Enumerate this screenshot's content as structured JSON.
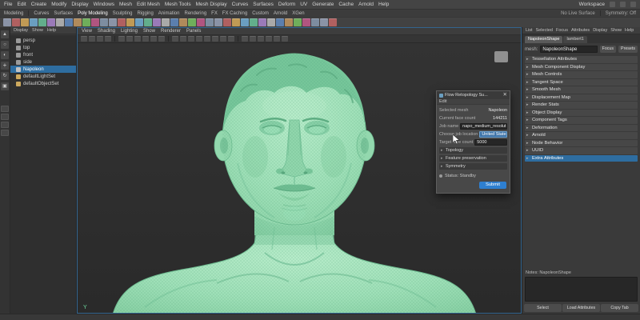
{
  "menubar": {
    "items": [
      "File",
      "Edit",
      "Create",
      "Modify",
      "Display",
      "Windows",
      "Mesh",
      "Edit Mesh",
      "Mesh Tools",
      "Mesh Display",
      "Curves",
      "Surfaces",
      "Deform",
      "UV",
      "Generate",
      "Cache",
      "Arnold",
      "Help"
    ],
    "workspace_label": "Workspace"
  },
  "statusline": {
    "menuset": "Modeling",
    "live_surface": "No Live Surface",
    "symmetry": "Symmetry: Off"
  },
  "shelf": {
    "tabs": [
      "Curves",
      "Surfaces",
      "Poly Modeling",
      "Sculpting",
      "Rigging",
      "Animation",
      "Rendering",
      "FX",
      "FX Caching",
      "Custom",
      "Arnold",
      "XGen"
    ]
  },
  "outliner": {
    "menus": [
      "Display",
      "Show",
      "Help"
    ],
    "items": [
      {
        "label": "persp"
      },
      {
        "label": "top"
      },
      {
        "label": "front"
      },
      {
        "label": "side"
      },
      {
        "label": "Napoleon"
      },
      {
        "label": "defaultLightSet"
      },
      {
        "label": "defaultObjectSet"
      }
    ]
  },
  "viewport": {
    "menus": [
      "View",
      "Shading",
      "Lighting",
      "Show",
      "Renderer",
      "Panels"
    ],
    "axis_label": "Y"
  },
  "dialog": {
    "title": "Flow Retopology Su...",
    "menu_label": "Edit",
    "selected_mesh_label": "Selected mesh",
    "selected_mesh_value": "Napoleon",
    "face_count_label": "Current face count",
    "face_count_value": "144211",
    "job_name_label": "Job name",
    "job_name_value": "napo_medium_resolution",
    "job_location_label": "Choose job location",
    "job_location_value": "United States",
    "target_count_label": "Target face count",
    "target_count_value": "5000",
    "sections": [
      "Topology",
      "Feature preservation",
      "Symmetry"
    ],
    "status_label": "Status: Standby",
    "submit_label": "Submit"
  },
  "attribute_editor": {
    "menus": [
      "List",
      "Selected",
      "Focus",
      "Attributes",
      "Display",
      "Show",
      "Help"
    ],
    "tabs": [
      "NapoleonShape",
      "lambert1"
    ],
    "node_type_label": "mesh:",
    "node_name": "NapoleonShape",
    "focus_label": "Focus",
    "presets_label": "Presets",
    "sections": [
      "Tessellation Attributes",
      "Mesh Component Display",
      "Mesh Controls",
      "Tangent Space",
      "Smooth Mesh",
      "Displacement Map",
      "Render Stats",
      "Object Display",
      "Component Tags",
      "Deformation",
      "Arnold",
      "Node Behavior",
      "UUID",
      "Extra Attributes"
    ],
    "notes_label": "Notes: NapoleonShape",
    "buttons": [
      "Select",
      "Load Attributes",
      "Copy Tab"
    ]
  },
  "colors": {
    "selection_blue": "#2e6da0",
    "submit_blue": "#2e7fd0",
    "bust_green": "#9fe0b6",
    "viewport_bg": "#2e2e2e"
  }
}
